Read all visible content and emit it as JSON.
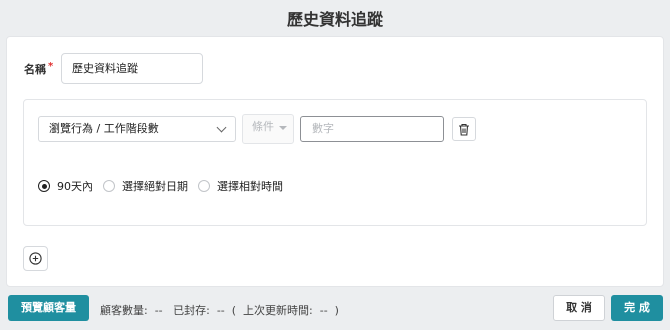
{
  "page": {
    "title": "歷史資料追蹤"
  },
  "form": {
    "name_label": "名稱",
    "required_mark": "*",
    "name_value": "歷史資料追蹤"
  },
  "rule": {
    "behavior_select": "瀏覽行為 / 工作階段數",
    "condition_placeholder": "條件",
    "number_placeholder": "數字",
    "date_options": [
      {
        "label": "90天內",
        "selected": true
      },
      {
        "label": "選擇絕對日期",
        "selected": false
      },
      {
        "label": "選擇相對時間",
        "selected": false
      }
    ]
  },
  "footer": {
    "preview_button": "預覽顧客量",
    "status_text": "顧客數量:  --   已封存:  --  (  上次更新時間:  --  )",
    "cancel_button": "取 消",
    "done_button": "完 成"
  },
  "colors": {
    "accent": "#1f8fa0",
    "required": "#e03131"
  },
  "icons": {
    "trash": "trash-icon",
    "add": "plus-circle-icon",
    "dropdown": "chevron-down-icon"
  }
}
